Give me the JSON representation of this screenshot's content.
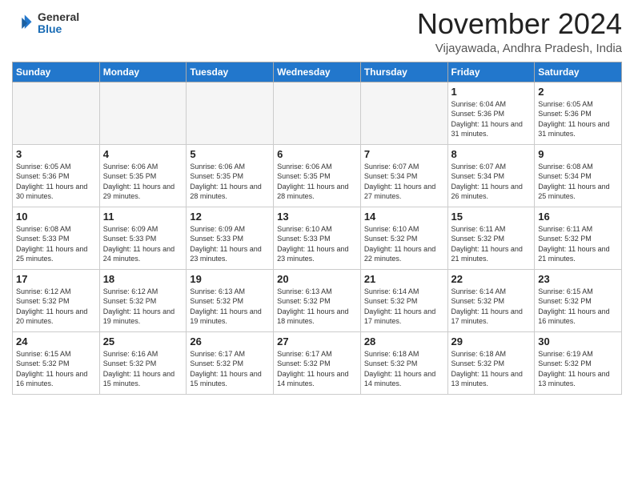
{
  "header": {
    "logo_general": "General",
    "logo_blue": "Blue",
    "month_title": "November 2024",
    "location": "Vijayawada, Andhra Pradesh, India"
  },
  "weekdays": [
    "Sunday",
    "Monday",
    "Tuesday",
    "Wednesday",
    "Thursday",
    "Friday",
    "Saturday"
  ],
  "weeks": [
    [
      {
        "day": "",
        "detail": ""
      },
      {
        "day": "",
        "detail": ""
      },
      {
        "day": "",
        "detail": ""
      },
      {
        "day": "",
        "detail": ""
      },
      {
        "day": "",
        "detail": ""
      },
      {
        "day": "1",
        "detail": "Sunrise: 6:04 AM\nSunset: 5:36 PM\nDaylight: 11 hours\nand 31 minutes."
      },
      {
        "day": "2",
        "detail": "Sunrise: 6:05 AM\nSunset: 5:36 PM\nDaylight: 11 hours\nand 31 minutes."
      }
    ],
    [
      {
        "day": "3",
        "detail": "Sunrise: 6:05 AM\nSunset: 5:36 PM\nDaylight: 11 hours\nand 30 minutes."
      },
      {
        "day": "4",
        "detail": "Sunrise: 6:06 AM\nSunset: 5:35 PM\nDaylight: 11 hours\nand 29 minutes."
      },
      {
        "day": "5",
        "detail": "Sunrise: 6:06 AM\nSunset: 5:35 PM\nDaylight: 11 hours\nand 28 minutes."
      },
      {
        "day": "6",
        "detail": "Sunrise: 6:06 AM\nSunset: 5:35 PM\nDaylight: 11 hours\nand 28 minutes."
      },
      {
        "day": "7",
        "detail": "Sunrise: 6:07 AM\nSunset: 5:34 PM\nDaylight: 11 hours\nand 27 minutes."
      },
      {
        "day": "8",
        "detail": "Sunrise: 6:07 AM\nSunset: 5:34 PM\nDaylight: 11 hours\nand 26 minutes."
      },
      {
        "day": "9",
        "detail": "Sunrise: 6:08 AM\nSunset: 5:34 PM\nDaylight: 11 hours\nand 25 minutes."
      }
    ],
    [
      {
        "day": "10",
        "detail": "Sunrise: 6:08 AM\nSunset: 5:33 PM\nDaylight: 11 hours\nand 25 minutes."
      },
      {
        "day": "11",
        "detail": "Sunrise: 6:09 AM\nSunset: 5:33 PM\nDaylight: 11 hours\nand 24 minutes."
      },
      {
        "day": "12",
        "detail": "Sunrise: 6:09 AM\nSunset: 5:33 PM\nDaylight: 11 hours\nand 23 minutes."
      },
      {
        "day": "13",
        "detail": "Sunrise: 6:10 AM\nSunset: 5:33 PM\nDaylight: 11 hours\nand 23 minutes."
      },
      {
        "day": "14",
        "detail": "Sunrise: 6:10 AM\nSunset: 5:32 PM\nDaylight: 11 hours\nand 22 minutes."
      },
      {
        "day": "15",
        "detail": "Sunrise: 6:11 AM\nSunset: 5:32 PM\nDaylight: 11 hours\nand 21 minutes."
      },
      {
        "day": "16",
        "detail": "Sunrise: 6:11 AM\nSunset: 5:32 PM\nDaylight: 11 hours\nand 21 minutes."
      }
    ],
    [
      {
        "day": "17",
        "detail": "Sunrise: 6:12 AM\nSunset: 5:32 PM\nDaylight: 11 hours\nand 20 minutes."
      },
      {
        "day": "18",
        "detail": "Sunrise: 6:12 AM\nSunset: 5:32 PM\nDaylight: 11 hours\nand 19 minutes."
      },
      {
        "day": "19",
        "detail": "Sunrise: 6:13 AM\nSunset: 5:32 PM\nDaylight: 11 hours\nand 19 minutes."
      },
      {
        "day": "20",
        "detail": "Sunrise: 6:13 AM\nSunset: 5:32 PM\nDaylight: 11 hours\nand 18 minutes."
      },
      {
        "day": "21",
        "detail": "Sunrise: 6:14 AM\nSunset: 5:32 PM\nDaylight: 11 hours\nand 17 minutes."
      },
      {
        "day": "22",
        "detail": "Sunrise: 6:14 AM\nSunset: 5:32 PM\nDaylight: 11 hours\nand 17 minutes."
      },
      {
        "day": "23",
        "detail": "Sunrise: 6:15 AM\nSunset: 5:32 PM\nDaylight: 11 hours\nand 16 minutes."
      }
    ],
    [
      {
        "day": "24",
        "detail": "Sunrise: 6:15 AM\nSunset: 5:32 PM\nDaylight: 11 hours\nand 16 minutes."
      },
      {
        "day": "25",
        "detail": "Sunrise: 6:16 AM\nSunset: 5:32 PM\nDaylight: 11 hours\nand 15 minutes."
      },
      {
        "day": "26",
        "detail": "Sunrise: 6:17 AM\nSunset: 5:32 PM\nDaylight: 11 hours\nand 15 minutes."
      },
      {
        "day": "27",
        "detail": "Sunrise: 6:17 AM\nSunset: 5:32 PM\nDaylight: 11 hours\nand 14 minutes."
      },
      {
        "day": "28",
        "detail": "Sunrise: 6:18 AM\nSunset: 5:32 PM\nDaylight: 11 hours\nand 14 minutes."
      },
      {
        "day": "29",
        "detail": "Sunrise: 6:18 AM\nSunset: 5:32 PM\nDaylight: 11 hours\nand 13 minutes."
      },
      {
        "day": "30",
        "detail": "Sunrise: 6:19 AM\nSunset: 5:32 PM\nDaylight: 11 hours\nand 13 minutes."
      }
    ]
  ]
}
